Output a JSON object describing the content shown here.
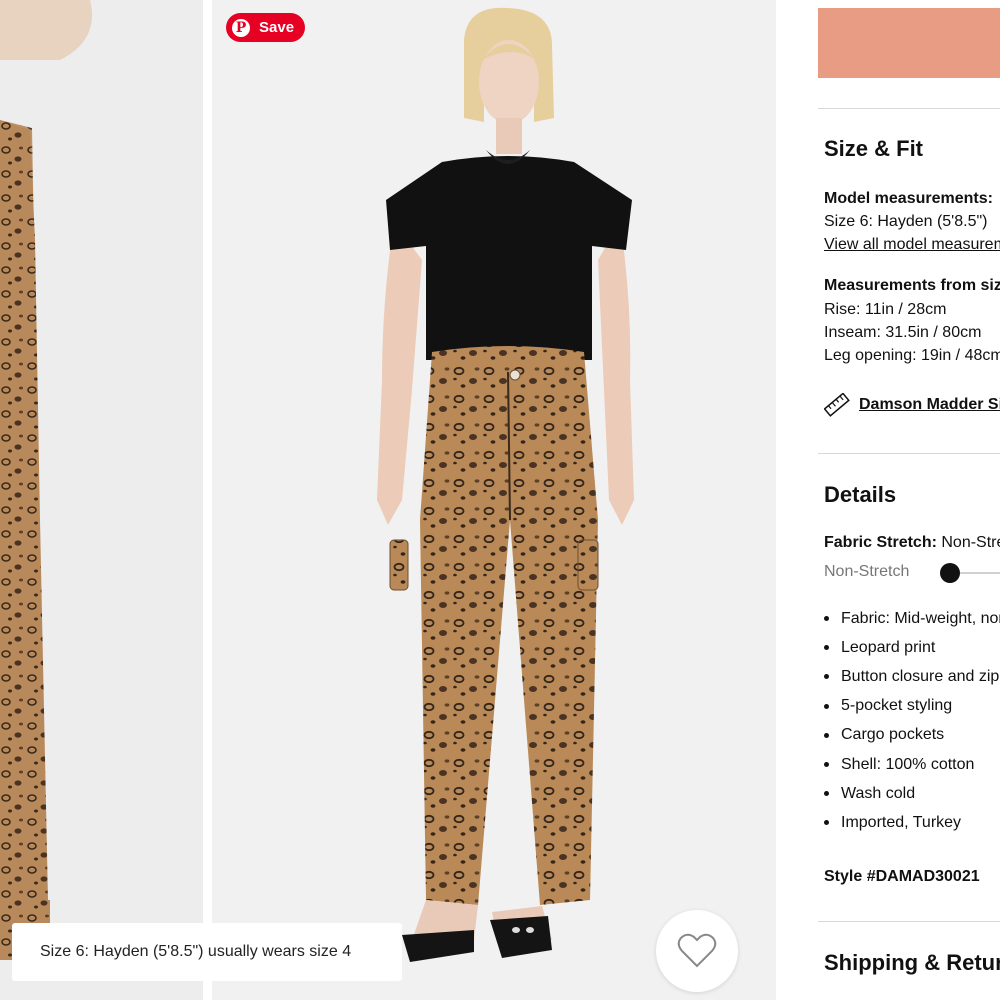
{
  "gallery": {
    "save_label": "Save",
    "pin_glyph": "P",
    "size_caption": "Size 6: Hayden (5'8.5\") usually wears size 4",
    "wishlist_icon": "heart-icon",
    "colors": {
      "pinterest": "#e60023",
      "leopard_base": "#b8895a"
    }
  },
  "panel": {
    "add_to_bag_color": "#e89c84",
    "size_fit": {
      "heading": "Size & Fit",
      "model_label": "Model measurements:",
      "model_value": "Size 6: Hayden (5'8.5\")",
      "view_all_link": "View all model measurements",
      "measure_label": "Measurements from size",
      "rise": "Rise: 11in / 28cm",
      "inseam": "Inseam: 31.5in / 80cm",
      "leg_opening": "Leg opening: 19in / 48cm",
      "size_guide_link": "Damson Madder Size Guide",
      "size_guide_icon": "ruler-icon"
    },
    "details": {
      "heading": "Details",
      "stretch_label": "Fabric Stretch:",
      "stretch_value": "Non-Stretch",
      "stretch_scale_label": "Non-Stretch",
      "bullets": [
        "Fabric: Mid-weight, non-stretch denim",
        "Leopard print",
        "Button closure and zip fly",
        "5-pocket styling",
        "Cargo pockets",
        "Shell: 100% cotton",
        "Wash cold",
        "Imported, Turkey"
      ],
      "style_number": "Style #DAMAD30021"
    },
    "shipping_heading": "Shipping & Returns"
  }
}
